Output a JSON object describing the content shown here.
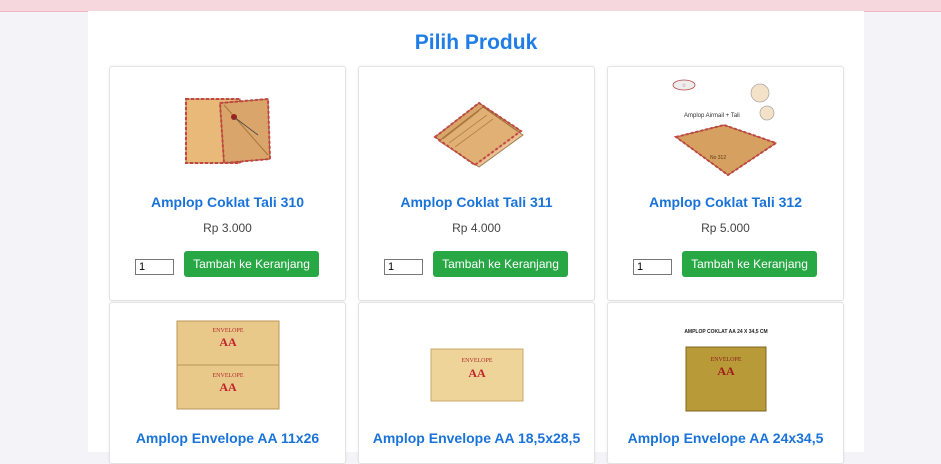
{
  "page": {
    "title": "Pilih Produk"
  },
  "products": [
    {
      "name": "Amplop Coklat Tali 310",
      "price": "Rp 3.000",
      "qty": "1",
      "button": "Tambah ke Keranjang"
    },
    {
      "name": "Amplop Coklat Tali 311",
      "price": "Rp 4.000",
      "qty": "1",
      "button": "Tambah ke Keranjang"
    },
    {
      "name": "Amplop Coklat Tali 312",
      "price": "Rp 5.000",
      "qty": "1",
      "button": "Tambah ke Keranjang"
    },
    {
      "name": "Amplop Envelope AA 11x26"
    },
    {
      "name": "Amplop Envelope AA 18,5x28,5"
    },
    {
      "name": "Amplop Envelope AA 24x34,5"
    }
  ],
  "image_text": {
    "product_3_top_label": "Amplop Airmail + Tali",
    "product_3_small_label": "No 312",
    "product_6_top_label": "AMPLOP COKLAT AA 24 X 34,5 CM",
    "envelope_brand": "ENVELOPE",
    "envelope_mark": "AA"
  },
  "colors": {
    "title": "#1e7de6",
    "product_name": "#1a73d9",
    "button": "#28a745",
    "panel": "#ffffff",
    "background": "#f4f4f8"
  }
}
